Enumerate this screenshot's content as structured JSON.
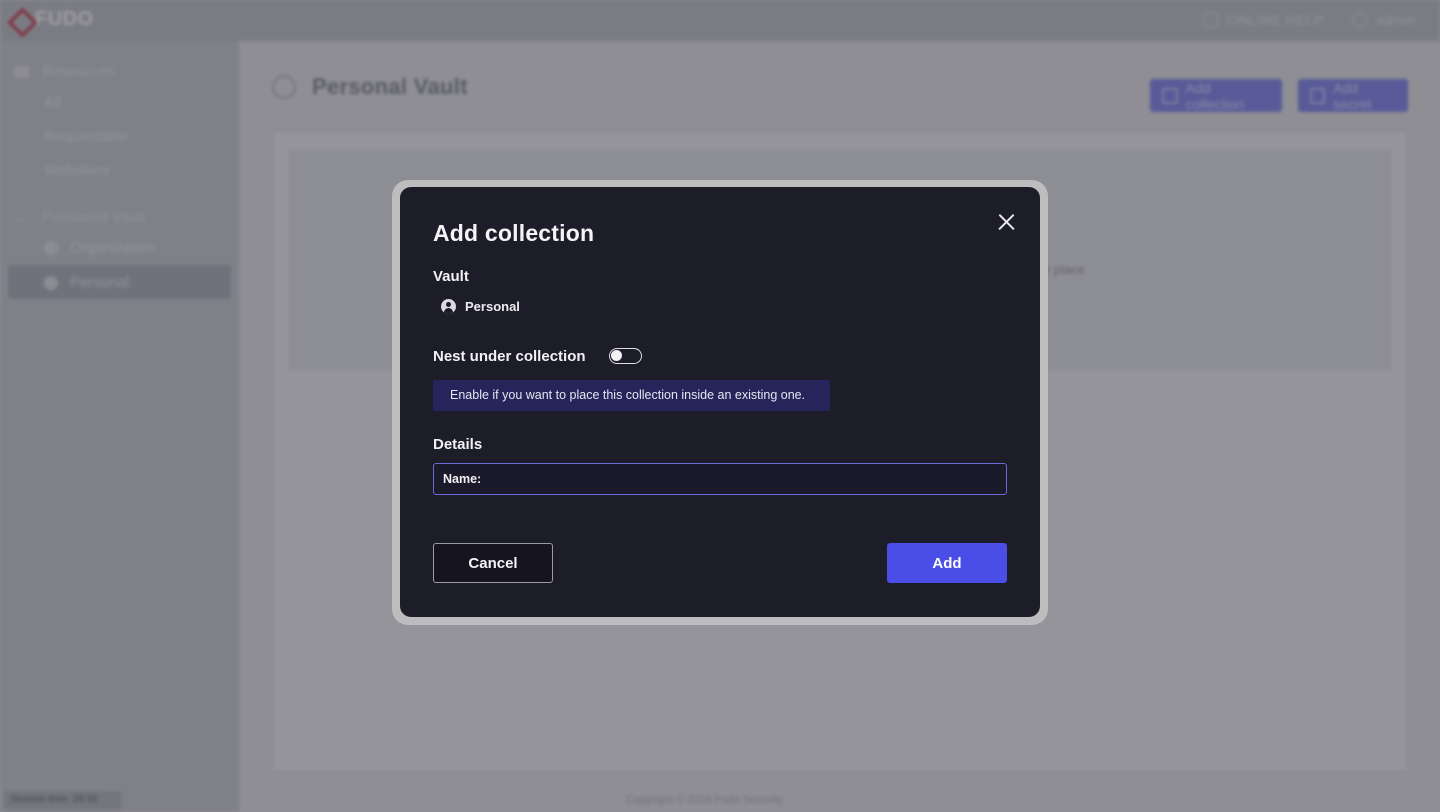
{
  "app": {
    "logo_text": "FUDO",
    "topbar": {
      "help_label": "ONLINE HELP",
      "help_icon": "book-icon",
      "user_label": "admin",
      "user_icon": "user-circle-icon"
    },
    "sidebar": {
      "resources_label": "Resources",
      "resources_items": [
        "All",
        "Requestable",
        "Webclient"
      ],
      "vault_label": "Password Vault",
      "vault_items": [
        "Organization",
        "Personal"
      ],
      "active_item": "Personal",
      "session_text": "Session time: 28:32"
    },
    "page": {
      "title": "Personal Vault",
      "add_collection_label": "Add collection",
      "add_secret_label": "Add secret",
      "panel_text": "in place",
      "footer": "Copyright © 2024 Fudo Security"
    }
  },
  "modal": {
    "title": "Add collection",
    "vault_label": "Vault",
    "vault_name": "Personal",
    "nest_label": "Nest under collection",
    "nest_enabled": false,
    "hint": "Enable if you want to place this collection inside an existing one.",
    "details_label": "Details",
    "name_label": "Name:",
    "name_value": "",
    "cancel_label": "Cancel",
    "add_label": "Add"
  },
  "colors": {
    "accent": "#4a4ee6",
    "modal_bg": "#1d1c29",
    "hint_bg": "#25255c",
    "brand": "#d2465a"
  }
}
